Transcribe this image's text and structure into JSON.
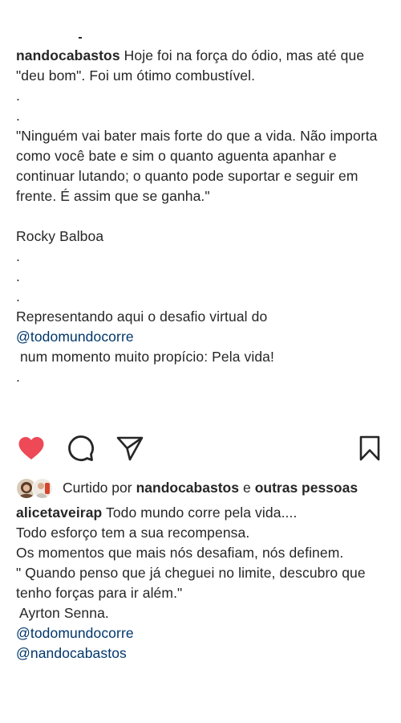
{
  "post": {
    "author": "nandocabastos",
    "caption_lines": [
      "Hoje foi na força do ódio, mas até que \"deu bom\". Foi um ótimo combustível.",
      ".",
      ".",
      "\"Ninguém vai bater mais forte do que a vida. Não importa como você bate e sim o quanto aguenta apanhar e continuar lutando; o quanto pode suportar e seguir em frente. É assim que se ganha.\"",
      "",
      "Rocky Balboa",
      ".",
      ".",
      ".",
      "Representando aqui o desafio virtual do",
      "@todomundocorre",
      " num momento muito propício: Pela vida!",
      "."
    ]
  },
  "actions": {
    "like_icon": "heart-filled-icon",
    "comment_icon": "comment-bubble-icon",
    "share_icon": "paper-plane-icon",
    "save_icon": "bookmark-icon",
    "like_color": "#ed4956"
  },
  "likes": {
    "prefix": "Curtido por",
    "user": "nandocabastos",
    "connector": "e",
    "others": "outras pessoas"
  },
  "comment": {
    "author": "alicetaveirap",
    "first_line": "Todo mundo corre pela vida....",
    "lines": [
      "Todo esforço tem a sua recompensa.",
      "Os momentos que mais nós desafiam, nós definem.",
      "\" Quando penso que já cheguei no limite, descubro que tenho forças para ir além.\"",
      " Ayrton Senna.",
      "@todomundocorre",
      "@nandocabastos"
    ]
  }
}
